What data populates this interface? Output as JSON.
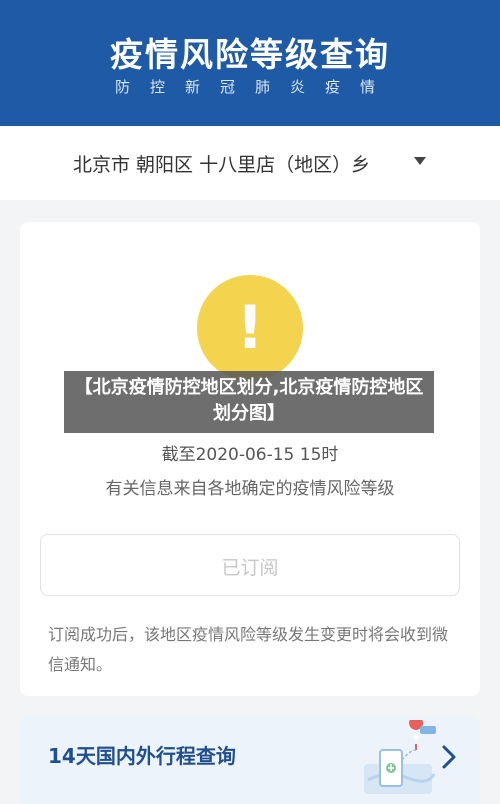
{
  "header": {
    "title": "疫情风险等级查询",
    "subtitle": "防控新冠肺炎疫情"
  },
  "location": {
    "text": "北京市 朝阳区 十八里店（地区）乡"
  },
  "status": {
    "icon": "warning-icon",
    "icon_color": "#f4d34f",
    "mark": "!"
  },
  "overlay": {
    "text": "【北京疫情防控地区划分,北京疫情防控地区划分图】"
  },
  "update": {
    "date_line": "截至2020-06-15 15时",
    "source_line": "有关信息来自各地确定的疫情风险等级"
  },
  "subscribe": {
    "label": "已订阅"
  },
  "notice": {
    "text": "订阅成功后，该地区疫情风险等级发生变更时将会收到微信通知。"
  },
  "travel": {
    "label": "14天国内外行程查询",
    "icon": "map-illustration-icon"
  },
  "colors": {
    "header_bg": "#1f5aa6",
    "accent": "#1f4f8f"
  }
}
